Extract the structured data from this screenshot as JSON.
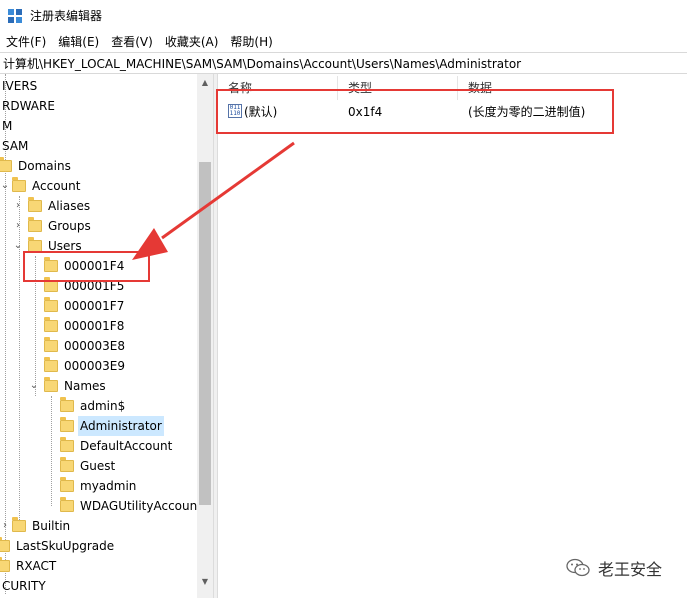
{
  "window": {
    "title": "注册表编辑器"
  },
  "menu": [
    "文件(F)",
    "编辑(E)",
    "查看(V)",
    "收藏夹(A)",
    "帮助(H)"
  ],
  "address": "计算机\\HKEY_LOCAL_MACHINE\\SAM\\SAM\\Domains\\Account\\Users\\Names\\Administrator",
  "tree": {
    "items": [
      {
        "label": "IVERS"
      },
      {
        "label": "RDWARE"
      },
      {
        "label": "M"
      },
      {
        "label": "SAM"
      },
      {
        "label": "Domains"
      },
      {
        "label": "Account"
      },
      {
        "label": "Aliases"
      },
      {
        "label": "Groups"
      },
      {
        "label": "Users"
      },
      {
        "label": "000001F4"
      },
      {
        "label": "000001F5"
      },
      {
        "label": "000001F7"
      },
      {
        "label": "000001F8"
      },
      {
        "label": "000003E8"
      },
      {
        "label": "000003E9"
      },
      {
        "label": "Names"
      },
      {
        "label": "admin$"
      },
      {
        "label": "Administrator",
        "selected": true
      },
      {
        "label": "DefaultAccount"
      },
      {
        "label": "Guest"
      },
      {
        "label": "myadmin"
      },
      {
        "label": "WDAGUtilityAccount"
      },
      {
        "label": "Builtin"
      },
      {
        "label": "LastSkuUpgrade"
      },
      {
        "label": "RXACT"
      },
      {
        "label": "CURITY"
      }
    ]
  },
  "list": {
    "columns": [
      "名称",
      "类型",
      "数据"
    ],
    "rows": [
      {
        "name": "(默认)",
        "type": "0x1f4",
        "data": "(长度为零的二进制值)",
        "icon": "binary-value-icon"
      }
    ]
  },
  "icons": {
    "app": "regedit-icon",
    "folder": "folder-icon",
    "watermark": "wechat-icon"
  },
  "annotation": {
    "color": "#e53935"
  },
  "watermark": {
    "text": "老王安全"
  }
}
